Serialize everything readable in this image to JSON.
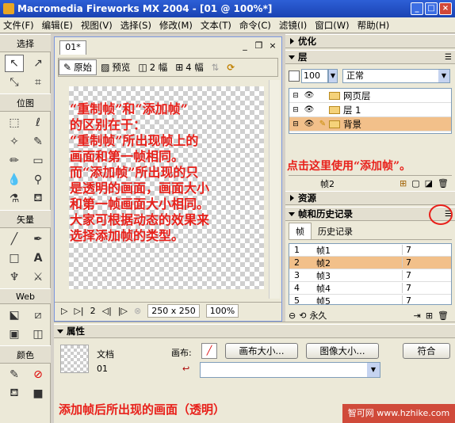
{
  "window": {
    "title": "Macromedia Fireworks MX 2004 - [01 @ 100%*]",
    "buttons": [
      "_",
      "□",
      "×"
    ]
  },
  "menubar": {
    "items": [
      "文件(F)",
      "编辑(E)",
      "视图(V)",
      "选择(S)",
      "修改(M)",
      "文本(T)",
      "命令(C)",
      "滤镜(I)",
      "窗口(W)",
      "帮助(H)"
    ]
  },
  "tools": {
    "select_label": "选择",
    "bitmap_label": "位图",
    "vector_label": "矢量",
    "web_label": "Web",
    "colors_label": "颜色"
  },
  "document": {
    "tab": "01*",
    "window_buttons": [
      "_",
      "❐",
      "×"
    ],
    "view_original": "原始",
    "view_preview": "预览",
    "view_2up": "2 幅",
    "view_4up": "4 幅",
    "frame_number": "2",
    "canvas_size": "250 x 250",
    "zoom": "100%"
  },
  "annotation": {
    "main_lines": [
      "“重制帧”和“添加帧”",
      "的区别在于：",
      "“重制帧”所出现帧上的",
      "画面和第一帧相同。",
      "而“添加帧”所出现的只",
      "是透明的画面，画面大小",
      "和第一帧画面大小相同。",
      "大家可根据动态的效果来",
      "选择添加帧的类型。"
    ],
    "callout": "点击这里使用“添加帧”。",
    "bottom": "添加帧后所出现的画面（透明）"
  },
  "panels": {
    "optimize": "优化",
    "layers": "层",
    "opacity": "100",
    "blend_mode": "正常",
    "layer_rows": [
      {
        "name": "网页层"
      },
      {
        "name": "层 1"
      },
      {
        "name": "背景"
      }
    ],
    "layer_footer": "帧2",
    "assets": "资源",
    "frames_history": "帧和历史记录",
    "tab_frames": "帧",
    "tab_history": "历史记录",
    "frame_rows": [
      {
        "num": "1",
        "name": "帧1",
        "delay": "7"
      },
      {
        "num": "2",
        "name": "帧2",
        "delay": "7"
      },
      {
        "num": "3",
        "name": "帧3",
        "delay": "7"
      },
      {
        "num": "4",
        "name": "帧4",
        "delay": "7"
      },
      {
        "num": "5",
        "name": "帧5",
        "delay": "7"
      }
    ],
    "loop": "永久"
  },
  "properties": {
    "header": "属性",
    "doc_label": "文档",
    "doc_name": "01",
    "canvas_label": "画布:",
    "canvas_size_btn": "画布大小...",
    "image_size_btn": "图像大小...",
    "fit_btn": "符合"
  },
  "watermark": "智可网 www.hzhike.com"
}
